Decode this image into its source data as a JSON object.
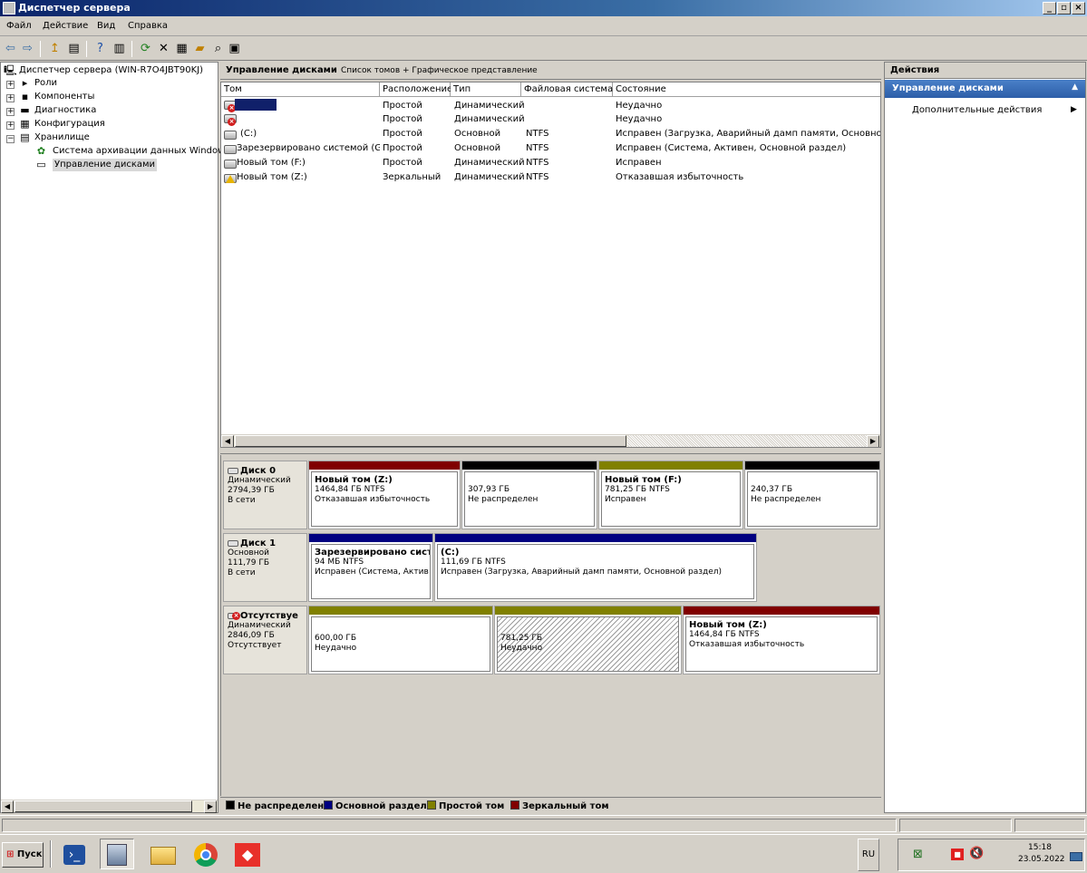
{
  "window": {
    "title": "Диспетчер сервера"
  },
  "menu": [
    "Файл",
    "Действие",
    "Вид",
    "Справка"
  ],
  "tree": {
    "root": "Диспетчер сервера (WIN-R7O4JBT90KJ)",
    "roles": "Роли",
    "features": "Компоненты",
    "diagnostics": "Диагностика",
    "configuration": "Конфигурация",
    "storage": "Хранилище",
    "backup": "Система архивации данных Windows",
    "disk_management": "Управление дисками"
  },
  "center": {
    "title": "Управление дисками",
    "view": "Список томов + Графическое представление"
  },
  "volumes": {
    "columns": [
      "Том",
      "Расположение",
      "Тип",
      "Файловая система",
      "Состояние"
    ],
    "rows": [
      {
        "name": "",
        "layout": "Простой",
        "type": "Динамический",
        "fs": "",
        "status": "Неудачно"
      },
      {
        "name": "",
        "layout": "Простой",
        "type": "Динамический",
        "fs": "",
        "status": "Неудачно"
      },
      {
        "name": "(C:)",
        "layout": "Простой",
        "type": "Основной",
        "fs": "NTFS",
        "status": "Исправен (Загрузка, Аварийный дамп памяти, Основной раз"
      },
      {
        "name": "Зарезервировано системой (G:)",
        "layout": "Простой",
        "type": "Основной",
        "fs": "NTFS",
        "status": "Исправен (Система, Активен, Основной раздел)"
      },
      {
        "name": "Новый том (F:)",
        "layout": "Простой",
        "type": "Динамический",
        "fs": "NTFS",
        "status": "Исправен"
      },
      {
        "name": "Новый том (Z:)",
        "layout": "Зеркальный",
        "type": "Динамический",
        "fs": "NTFS",
        "status": "Отказавшая избыточность"
      }
    ]
  },
  "disks": [
    {
      "name": "Диск 0",
      "kind": "Динамический",
      "size": "2794,39 ГБ",
      "state": "В сети",
      "partitions": [
        {
          "name": "Новый том  (Z:)",
          "size": "1464,84 ГБ NTFS",
          "status": "Отказавшая избыточность",
          "color": "#800000"
        },
        {
          "name": "",
          "size": "307,93 ГБ",
          "status": "Не распределен",
          "color": "#000000"
        },
        {
          "name": "Новый том  (F:)",
          "size": "781,25 ГБ NTFS",
          "status": "Исправен",
          "color": "#808000"
        },
        {
          "name": "",
          "size": "240,37 ГБ",
          "status": "Не распределен",
          "color": "#000000"
        }
      ]
    },
    {
      "name": "Диск 1",
      "kind": "Основной",
      "size": "111,79 ГБ",
      "state": "В сети",
      "partitions": [
        {
          "name": "Зарезервировано сист",
          "size": "94 МБ NTFS",
          "status": "Исправен (Система, Актив",
          "color": "#000080"
        },
        {
          "name": "(C:)",
          "size": "111,69 ГБ NTFS",
          "status": "Исправен (Загрузка, Аварийный дамп памяти, Основной раздел)",
          "color": "#000080"
        }
      ]
    },
    {
      "name": "Отсутствуе",
      "kind": "Динамический",
      "size": "2846,09 ГБ",
      "state": "Отсутствует",
      "partitions": [
        {
          "name": "",
          "size": "600,00 ГБ",
          "status": "Неудачно",
          "color": "#808000"
        },
        {
          "name": "",
          "size": "781,25 ГБ",
          "status": "Неудачно",
          "color": "#808000"
        },
        {
          "name": "Новый том  (Z:)",
          "size": "1464,84 ГБ NTFS",
          "status": "Отказавшая избыточность",
          "color": "#800000"
        }
      ]
    }
  ],
  "legend": [
    {
      "label": "Не распределен",
      "color": "#000000"
    },
    {
      "label": "Основной раздел",
      "color": "#000080"
    },
    {
      "label": "Простой том",
      "color": "#808000"
    },
    {
      "label": "Зеркальный том",
      "color": "#800000"
    }
  ],
  "actions": {
    "title": "Действия",
    "section": "Управление дисками",
    "item": "Дополнительные действия"
  },
  "taskbar": {
    "start": "Пуск",
    "lang": "RU",
    "time": "15:18",
    "date": "23.05.2022"
  },
  "colors": {
    "unallocated": "#000000",
    "primary": "#000080",
    "simple": "#808000",
    "mirror": "#800000",
    "accent": "#2c5ea8"
  }
}
